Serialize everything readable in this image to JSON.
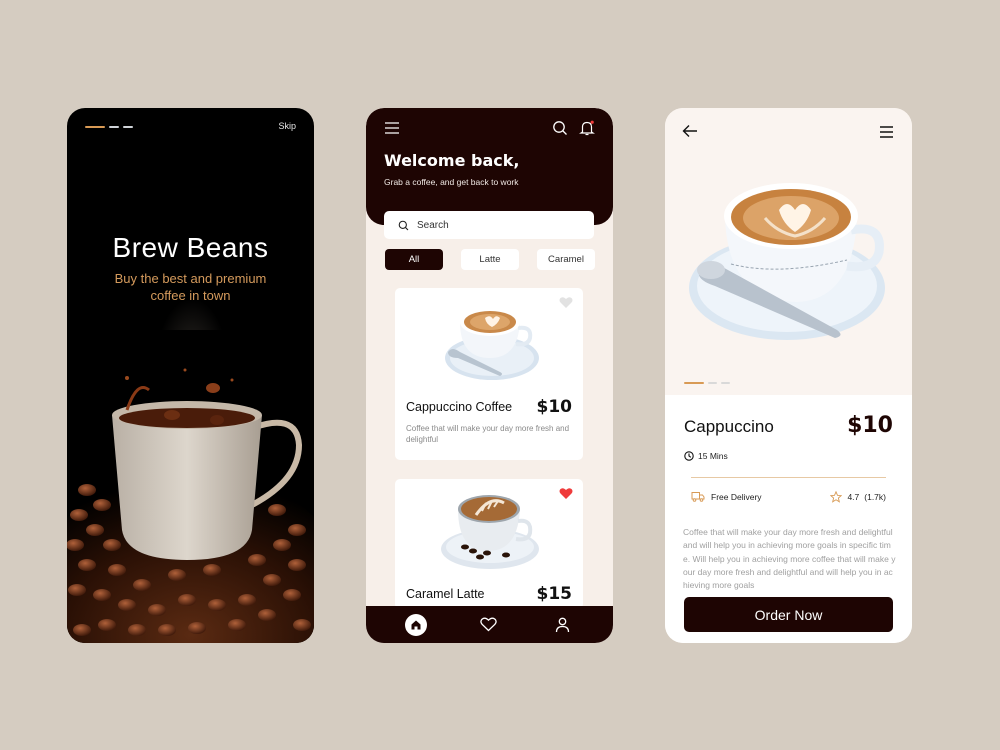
{
  "colors": {
    "background": "#d5ccc1",
    "dark_brown": "#1e0503",
    "accent_orange": "#d89a55",
    "cream": "#f7efe9",
    "favorite_red": "#ef3b3b"
  },
  "splash": {
    "skip_label": "Skip",
    "title": "Brew Beans",
    "subtitle": "Buy the best and premium coffee in town",
    "pager_active_index": 0,
    "pager_count": 3,
    "hero_image": "coffee-cup-splash-with-beans"
  },
  "home": {
    "greeting": "Welcome back,",
    "greeting_sub": "Grab a coffee, and get back to work",
    "search": {
      "placeholder": "Search"
    },
    "chips": [
      {
        "label": "All",
        "active": true
      },
      {
        "label": "Latte",
        "active": false
      },
      {
        "label": "Caramel",
        "active": false
      }
    ],
    "products": [
      {
        "name": "Cappuccino Coffee",
        "price": "$10",
        "description": "Coffee that will make your day more fresh and delightful",
        "favorite": false,
        "image": "cappuccino-cup"
      },
      {
        "name": "Caramel Latte",
        "price": "$15",
        "favorite": true,
        "image": "latte-cup-with-beans"
      }
    ],
    "nav": [
      {
        "icon": "home-icon",
        "active": true
      },
      {
        "icon": "heart-icon",
        "active": false
      },
      {
        "icon": "user-icon",
        "active": false
      }
    ],
    "notification_dot": true
  },
  "detail": {
    "product_name": "Cappuccino",
    "price": "$10",
    "time": "15 Mins",
    "delivery": "Free Delivery",
    "rating": "4.7",
    "rating_count": "(1.7k)",
    "description": "Coffee that will make your day more fresh and delightful and will help you in achieving more goals in specific time. Will help you in achieving more coffee that will make your day more fresh and delightful and will help you in achieving more goals",
    "order_label": "Order Now",
    "pager_active_index": 0,
    "pager_count": 3
  }
}
